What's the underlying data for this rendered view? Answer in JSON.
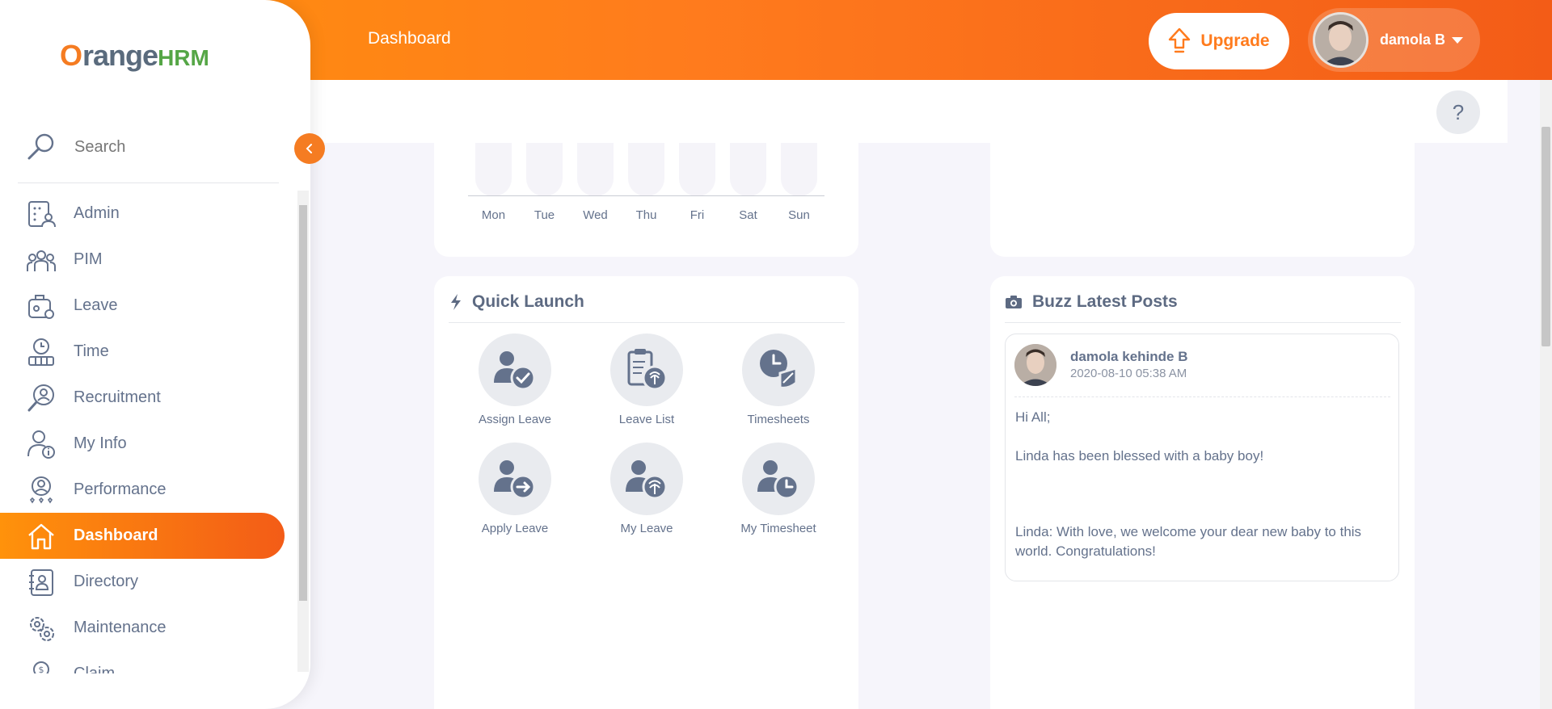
{
  "topbar": {
    "title": "Dashboard",
    "upgrade_label": "Upgrade",
    "user_name": "damola B"
  },
  "help": {
    "label": "?"
  },
  "sidebar": {
    "logo": {
      "o": "O",
      "range": "range",
      "hrm": "HRM"
    },
    "search_label": "Search",
    "items": [
      {
        "label": "Admin"
      },
      {
        "label": "PIM"
      },
      {
        "label": "Leave"
      },
      {
        "label": "Time"
      },
      {
        "label": "Recruitment"
      },
      {
        "label": "My Info"
      },
      {
        "label": "Performance"
      },
      {
        "label": "Dashboard"
      },
      {
        "label": "Directory"
      },
      {
        "label": "Maintenance"
      },
      {
        "label": "Claim"
      }
    ],
    "active": "Dashboard"
  },
  "week_chart": {
    "days": [
      "Mon",
      "Tue",
      "Wed",
      "Thu",
      "Fri",
      "Sat",
      "Sun"
    ]
  },
  "quick_launch": {
    "title": "Quick Launch",
    "items": [
      {
        "label": "Assign Leave"
      },
      {
        "label": "Leave List"
      },
      {
        "label": "Timesheets"
      },
      {
        "label": "Apply Leave"
      },
      {
        "label": "My Leave"
      },
      {
        "label": "My Timesheet"
      }
    ]
  },
  "buzz": {
    "title": "Buzz Latest Posts",
    "post": {
      "author": "damola kehinde B",
      "date": "2020-08-10 05:38 AM",
      "line1": "Hi All;",
      "line2": "Linda has been blessed with a baby boy!",
      "line3": "Linda: With love, we welcome your dear new baby to this world. Congratulations!"
    }
  },
  "colors": {
    "accent": "#ff7b1d",
    "text": "#64728c"
  }
}
